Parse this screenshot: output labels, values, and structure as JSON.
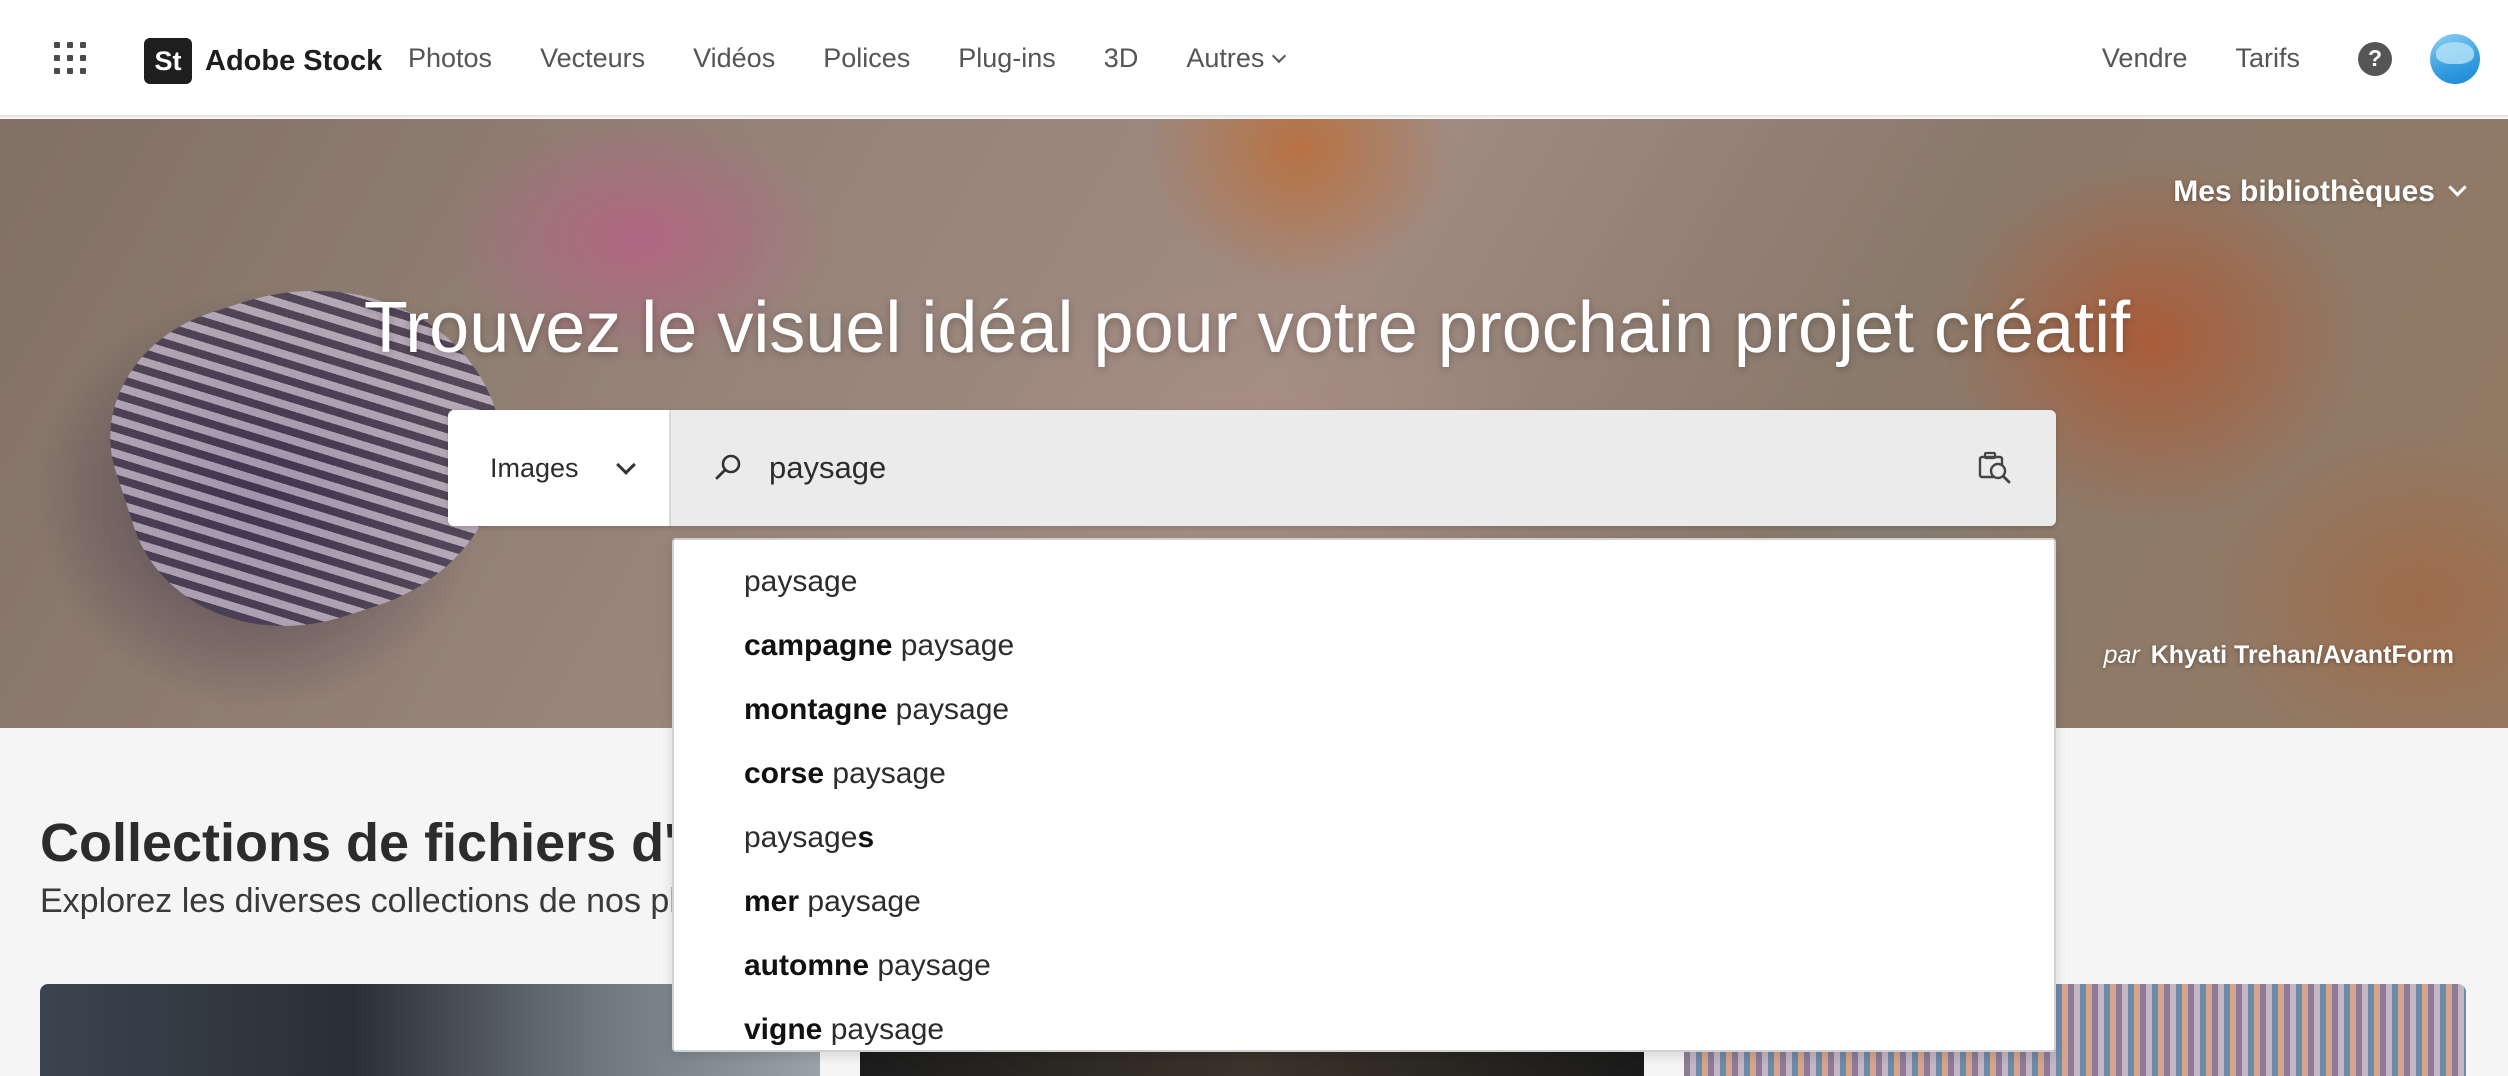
{
  "header": {
    "brand_logo_text": "St",
    "brand_name": "Adobe Stock",
    "nav": [
      "Photos",
      "Vecteurs",
      "Vidéos",
      "Polices",
      "Plug-ins",
      "3D",
      "Autres"
    ],
    "right": {
      "sell": "Vendre",
      "pricing": "Tarifs",
      "help": "?"
    }
  },
  "hero": {
    "title": "Trouvez le visuel idéal pour votre prochain projet créatif",
    "libraries": "Mes bibliothèques",
    "credit_prefix": "par",
    "credit_author": "Khyati Trehan/AvantForm"
  },
  "search": {
    "type_selected": "Images",
    "query": "paysage"
  },
  "suggestions": [
    {
      "bold": "",
      "text": "paysage"
    },
    {
      "bold": "campagne",
      "text": " paysage"
    },
    {
      "bold": "montagne",
      "text": " paysage"
    },
    {
      "bold": "corse",
      "text": " paysage"
    },
    {
      "prefix": "paysage",
      "bold": "s",
      "text": ""
    },
    {
      "bold": "mer",
      "text": " paysage"
    },
    {
      "bold": "automne",
      "text": " paysage"
    },
    {
      "bold": "vigne",
      "text": " paysage"
    }
  ],
  "collections": {
    "title": "Collections de fichiers d'exe",
    "subtitle": "Explorez les diverses collections de nos plus i"
  }
}
